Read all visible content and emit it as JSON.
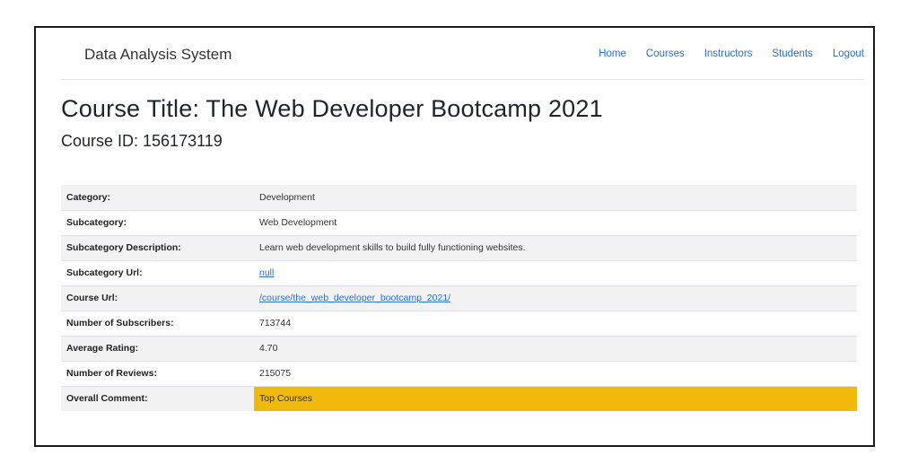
{
  "navbar": {
    "brand": "Data Analysis System",
    "links": [
      "Home",
      "Courses",
      "Instructors",
      "Students",
      "Logout"
    ]
  },
  "heading": {
    "title": "Course Title: The Web Developer Bootcamp 2021",
    "course_id": "Course ID: 156173119"
  },
  "details": [
    {
      "label": "Category:",
      "value": "Development"
    },
    {
      "label": "Subcategory:",
      "value": "Web Development"
    },
    {
      "label": "Subcategory Description:",
      "value": "Learn web development skills to build fully functioning websites."
    },
    {
      "label": "Subcategory Url:",
      "value": "null"
    },
    {
      "label": "Course Url:",
      "value": "/course/the_web_developer_bootcamp_2021/"
    },
    {
      "label": "Number of Subscribers:",
      "value": "713744"
    },
    {
      "label": "Average Rating:",
      "value": "4.70"
    },
    {
      "label": "Number of Reviews:",
      "value": "215075"
    },
    {
      "label": "Overall Comment:",
      "value": "Top Courses"
    }
  ],
  "colors": {
    "link": "#2a6ed8",
    "highlight": "#f0b90b",
    "stripe": "#f2f2f2"
  }
}
